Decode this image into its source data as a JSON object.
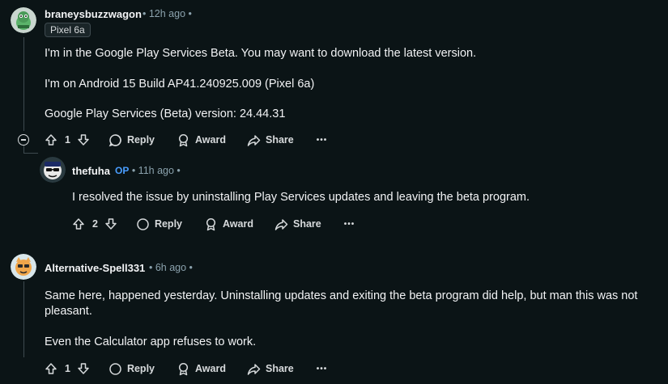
{
  "comments": [
    {
      "username": "braneysbuzzwagon",
      "time": "• 12h ago •",
      "flair": "Pixel 6a",
      "paragraphs": [
        "I'm in the Google Play Services Beta. You may want to download the latest version.",
        "I'm on Android 15 Build AP41.240925.009 (Pixel 6a)",
        "Google Play Services (Beta) version: 24.44.31"
      ],
      "votes": "1",
      "reply_label": "Reply",
      "award_label": "Award",
      "share_label": "Share",
      "more_label": "•••"
    },
    {
      "username": "thefuha",
      "op_badge": "OP",
      "time": "• 11h ago •",
      "paragraphs": [
        "I resolved the issue by uninstalling Play Services updates and leaving the beta program."
      ],
      "votes": "2",
      "reply_label": "Reply",
      "award_label": "Award",
      "share_label": "Share",
      "more_label": "•••"
    },
    {
      "username": "Alternative-Spell331",
      "time": "• 6h ago •",
      "paragraphs": [
        "Same here, happened yesterday. Uninstalling updates and exiting the beta program did help, but man this was not",
        "pleasant.",
        "Even the Calculator app refuses to work."
      ],
      "votes": "1",
      "reply_label": "Reply",
      "award_label": "Award",
      "share_label": "Share",
      "more_label": "•••"
    }
  ],
  "colors": {
    "background": "#0b1416",
    "text": "#f2f3f5",
    "meta": "#8ba2ad",
    "op": "#4a9eff",
    "thread_line": "#3e4a4f"
  }
}
